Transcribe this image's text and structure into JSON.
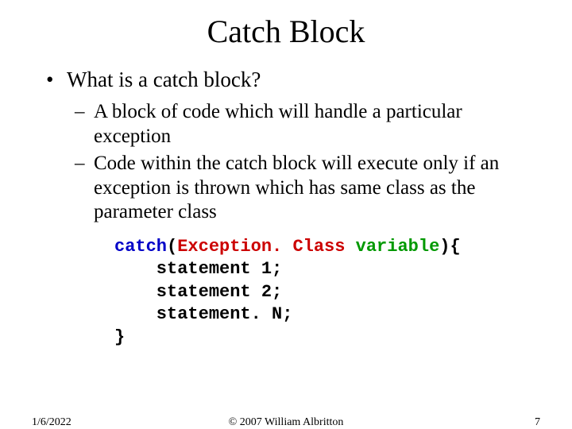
{
  "title": "Catch Block",
  "bullets": {
    "l1": "What is a catch block?",
    "l2a": "A block of code which will handle a particular exception",
    "l2b": "Code within the catch block will execute only if an exception is thrown which has same class as the parameter class"
  },
  "code": {
    "kw": "catch",
    "open_paren": "(",
    "cls": "Exception. Class",
    "space": " ",
    "var": "variable",
    "close_paren_brace": "){",
    "line2": "    statement 1;",
    "line3": "    statement 2;",
    "line4": "    statement. N;",
    "line5": "}"
  },
  "footer": {
    "date": "1/6/2022",
    "copyright": "© 2007 William Albritton",
    "page": "7"
  }
}
